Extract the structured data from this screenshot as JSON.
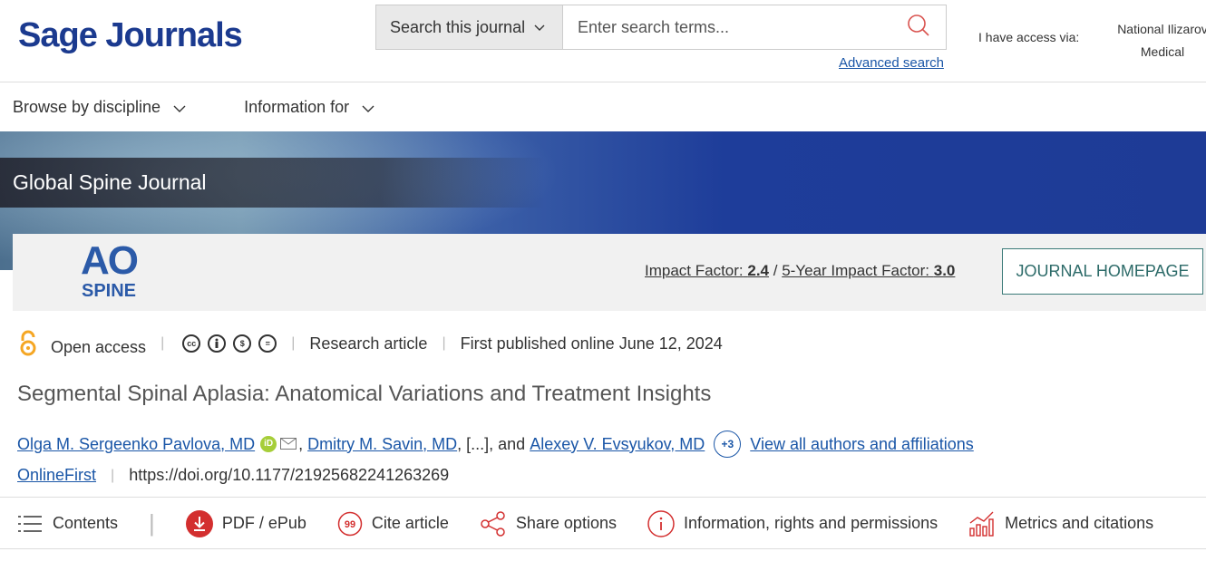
{
  "header": {
    "logo": "Sage Journals",
    "search_scope": "Search this journal",
    "search_placeholder": "Enter search terms...",
    "advanced_search": "Advanced search",
    "access_label": "I have access via:",
    "access_institution_line1": "National Ilizarov",
    "access_institution_line2": "Medical"
  },
  "nav": {
    "browse": "Browse by discipline",
    "info": "Information for"
  },
  "banner": {
    "journal_title": "Global Spine Journal"
  },
  "journal_bar": {
    "logo_top": "AO",
    "logo_bottom": "SPINE",
    "impact_label": "Impact Factor:",
    "impact_value": "2.4",
    "impact_sep": " / ",
    "five_year_label": "5-Year Impact Factor:",
    "five_year_value": "3.0",
    "homepage_button": "JOURNAL HOMEPAGE"
  },
  "meta": {
    "access": "Open access",
    "type": "Research article",
    "published": "First published online June 12, 2024"
  },
  "article": {
    "title": "Segmental Spinal Aplasia: Anatomical Variations and Treatment Insights",
    "author1": "Olga M. Sergeenko Pavlova, MD",
    "author2": "Dmitry M. Savin, MD",
    "ellipsis": ", [...], and ",
    "author3": "Alexey V. Evsyukov, MD",
    "more_count": "+3",
    "view_all": "View all authors and affiliations",
    "status": "OnlineFirst",
    "doi": "https://doi.org/10.1177/21925682241263269"
  },
  "toolbar": {
    "contents": "Contents",
    "pdf": "PDF / ePub",
    "cite": "Cite article",
    "share": "Share options",
    "info": "Information, rights and permissions",
    "metrics": "Metrics and citations"
  },
  "colors": {
    "brand": "#1b3a8f",
    "link": "#1a56a7",
    "accent_red": "#d32f2f",
    "teal": "#2d6b69",
    "open_access": "#f5a623"
  }
}
